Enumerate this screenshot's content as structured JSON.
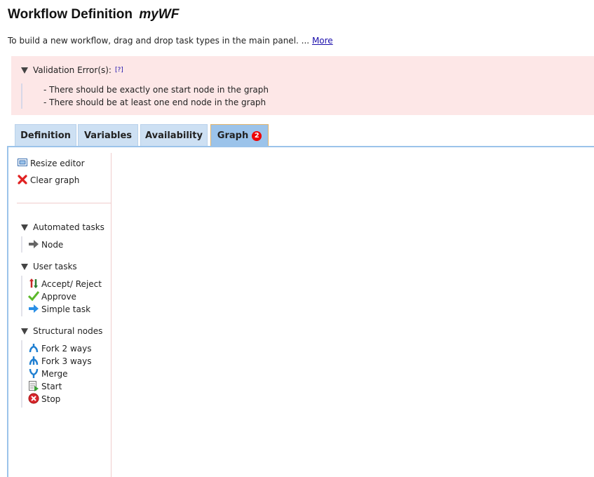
{
  "header": {
    "title": "Workflow Definition",
    "workflow_name": "myWF",
    "intro_text": "To build a new workflow, drag and drop task types in the main panel. ...",
    "more_link": "More"
  },
  "validation": {
    "heading": "Validation Error(s):",
    "help": "[?]",
    "errors": [
      "- There should be exactly one start node in the graph",
      "- There should be at least one end node in the graph"
    ]
  },
  "tabs": [
    {
      "label": "Definition"
    },
    {
      "label": "Variables"
    },
    {
      "label": "Availability"
    },
    {
      "label": "Graph",
      "badge": "2",
      "active": true
    }
  ],
  "toolbar": {
    "resize": "Resize editor",
    "clear": "Clear graph"
  },
  "palette": {
    "automated": {
      "title": "Automated tasks",
      "items": [
        "Node"
      ]
    },
    "user": {
      "title": "User tasks",
      "items": [
        "Accept/ Reject",
        "Approve",
        "Simple task"
      ]
    },
    "structural": {
      "title": "Structural nodes",
      "items": [
        "Fork 2 ways",
        "Fork 3 ways",
        "Merge",
        "Start",
        "Stop"
      ]
    }
  },
  "colors": {
    "error_bg": "#fde7e7",
    "tab_bg": "#cde0f3",
    "tab_active_bg": "#9bc3ea",
    "badge": "#ee0000"
  }
}
